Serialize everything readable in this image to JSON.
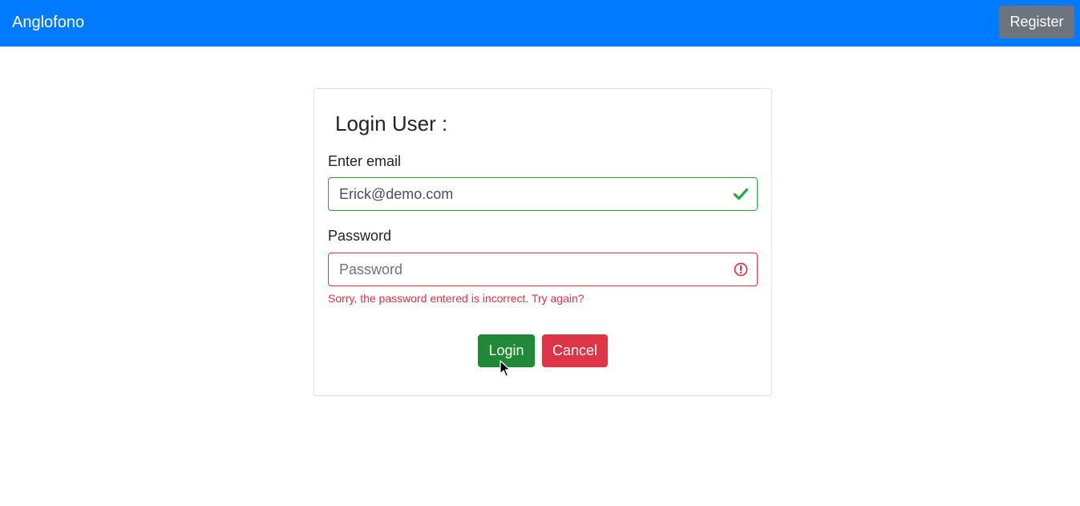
{
  "navbar": {
    "brand": "Anglofono",
    "register_label": "Register",
    "color": "#007bff"
  },
  "login_form": {
    "title": "Login User :",
    "email": {
      "label": "Enter email",
      "value": "Erick@demo.com",
      "state": "valid",
      "state_icon": "check-icon"
    },
    "password": {
      "label": "Password",
      "value": "",
      "placeholder": "Password",
      "state": "invalid",
      "state_icon": "exclamation-circle-icon",
      "error": "Sorry, the password entered is incorrect. Try again?"
    },
    "login_label": "Login",
    "cancel_label": "Cancel"
  },
  "colors": {
    "valid": "#28a745",
    "invalid": "#dc3545",
    "login_button": "#218838",
    "cancel_button": "#dc3545",
    "register_button": "#6c757d"
  }
}
